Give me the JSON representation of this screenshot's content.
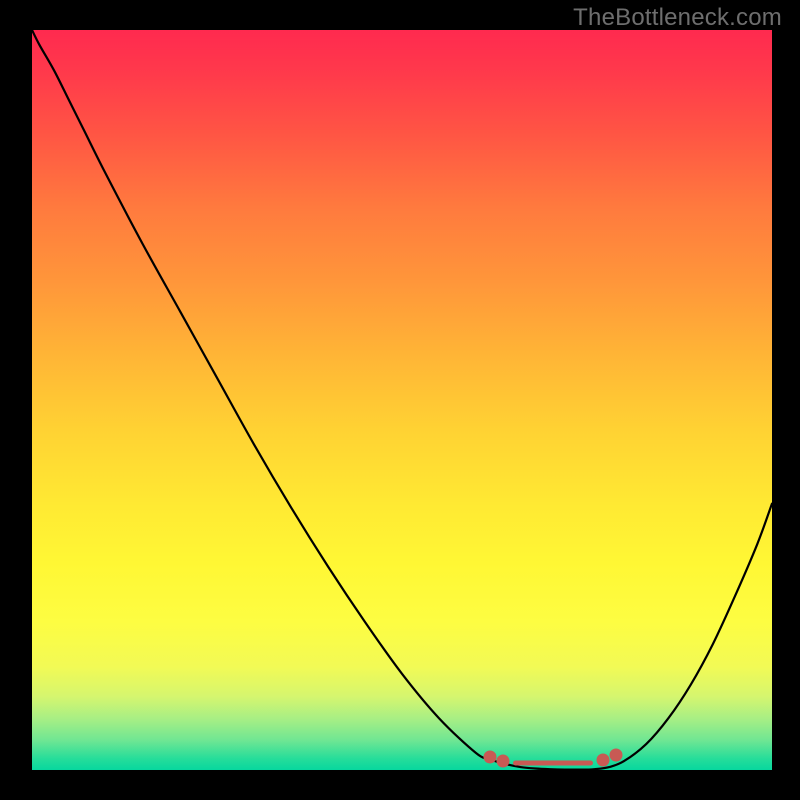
{
  "watermark": "TheBottleneck.com",
  "colors": {
    "black": "#000000",
    "curve": "#000000",
    "marker": "#c85a54"
  },
  "chart_data": {
    "type": "line",
    "title": "",
    "xlabel": "",
    "ylabel": "",
    "xlim": [
      0,
      100
    ],
    "ylim": [
      0,
      100
    ],
    "grid": false,
    "x": [
      0,
      1,
      3,
      5,
      7,
      10,
      15,
      20,
      25,
      30,
      35,
      40,
      45,
      50,
      55,
      60,
      62,
      64,
      66,
      68,
      70,
      72,
      74,
      75,
      76,
      78,
      80,
      83,
      86,
      89,
      92,
      95,
      98,
      100
    ],
    "values": [
      100,
      98,
      94.5,
      90.5,
      86.5,
      80.5,
      71,
      62,
      53,
      44,
      35.5,
      27.5,
      20,
      13,
      7,
      2.3,
      1.4,
      0.8,
      0.4,
      0.2,
      0.1,
      0.05,
      0.05,
      0.05,
      0.1,
      0.4,
      1.2,
      3.5,
      7,
      11.5,
      17,
      23.5,
      30.5,
      36
    ],
    "notes": "Curve rendered over a red-to-green vertical gradient. Flat minimum highlighted with red markers around x≈62-77."
  },
  "highlight": {
    "beads": [
      {
        "x_frac": 0.619,
        "y_frac": 0.983
      },
      {
        "x_frac": 0.636,
        "y_frac": 0.988
      },
      {
        "x_frac": 0.772,
        "y_frac": 0.987
      },
      {
        "x_frac": 0.789,
        "y_frac": 0.98
      }
    ],
    "dash": {
      "x1_frac": 0.65,
      "x2_frac": 0.758,
      "y_frac": 0.991
    }
  }
}
